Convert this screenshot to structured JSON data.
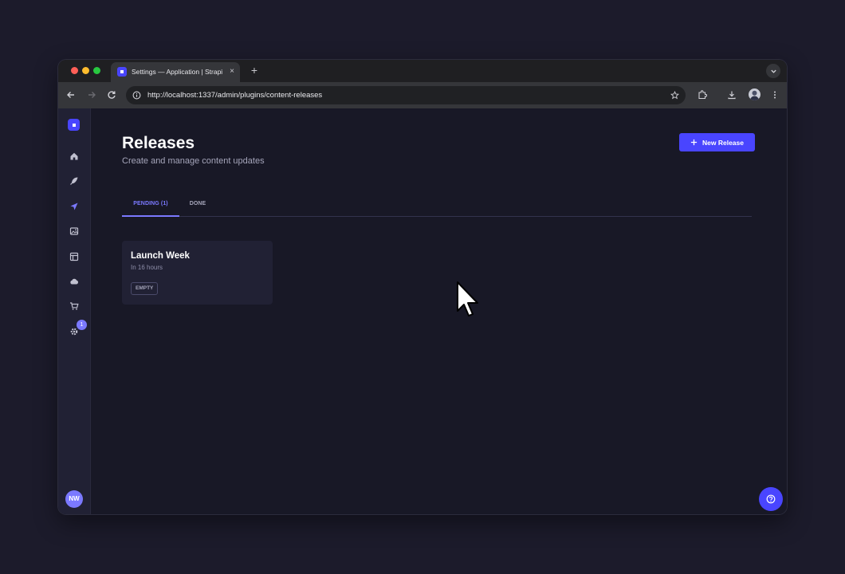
{
  "browser": {
    "tab": {
      "title": "Settings — Application | Strapi",
      "close_glyph": "×"
    },
    "new_tab_glyph": "+",
    "address_bar": {
      "url": "http://localhost:1337/admin/plugins/content-releases"
    }
  },
  "sidebar": {
    "items": [
      {
        "icon": "home-icon"
      },
      {
        "icon": "feather-icon"
      },
      {
        "icon": "paper-plane-icon",
        "active": true
      },
      {
        "icon": "image-icon"
      },
      {
        "icon": "layout-icon"
      },
      {
        "icon": "cloud-icon"
      },
      {
        "icon": "cart-icon"
      },
      {
        "icon": "gear-icon"
      }
    ],
    "settings_badge": "1",
    "avatar_initials": "NW"
  },
  "page": {
    "title": "Releases",
    "subtitle": "Create and manage content updates",
    "new_release_label": "New Release"
  },
  "tabs": [
    {
      "label": "PENDING (1)",
      "active": true
    },
    {
      "label": "DONE",
      "active": false
    }
  ],
  "releases": [
    {
      "name": "Launch Week",
      "scheduled": "In 16 hours",
      "status": "EMPTY"
    }
  ],
  "colors": {
    "accent": "#4945ff",
    "accent_light": "#7b79ff",
    "background": "#181826",
    "surface": "#212134"
  }
}
